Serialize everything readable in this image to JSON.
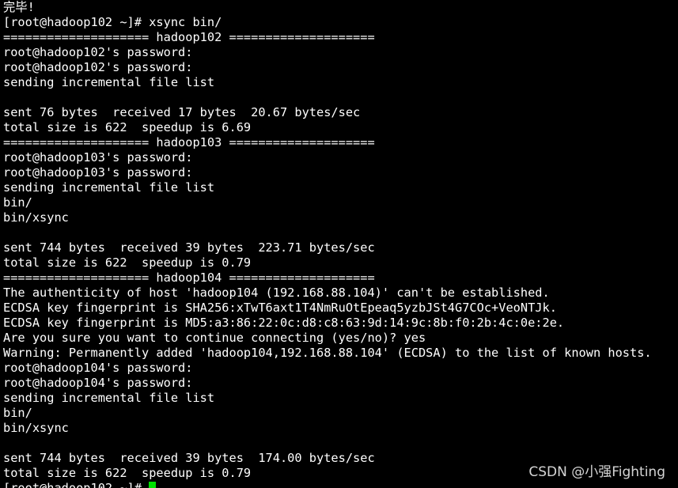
{
  "terminal": {
    "lines": [
      "完毕!",
      "[root@hadoop102 ~]# xsync bin/",
      "==================== hadoop102 ====================",
      "root@hadoop102's password:",
      "root@hadoop102's password:",
      "sending incremental file list",
      "",
      "sent 76 bytes  received 17 bytes  20.67 bytes/sec",
      "total size is 622  speedup is 6.69",
      "==================== hadoop103 ====================",
      "root@hadoop103's password:",
      "root@hadoop103's password:",
      "sending incremental file list",
      "bin/",
      "bin/xsync",
      "",
      "sent 744 bytes  received 39 bytes  223.71 bytes/sec",
      "total size is 622  speedup is 0.79",
      "==================== hadoop104 ====================",
      "The authenticity of host 'hadoop104 (192.168.88.104)' can't be established.",
      "ECDSA key fingerprint is SHA256:xTwT6axt1T4NmRuOtEpeaq5yzbJSt4G7COc+VeoNTJk.",
      "ECDSA key fingerprint is MD5:a3:86:22:0c:d8:c8:63:9d:14:9c:8b:f0:2b:4c:0e:2e.",
      "Are you sure you want to continue connecting (yes/no)? yes",
      "Warning: Permanently added 'hadoop104,192.168.88.104' (ECDSA) to the list of known hosts.",
      "root@hadoop104's password:",
      "root@hadoop104's password:",
      "sending incremental file list",
      "bin/",
      "bin/xsync",
      "",
      "sent 744 bytes  received 39 bytes  174.00 bytes/sec",
      "total size is 622  speedup is 0.79"
    ],
    "prompt": "[root@hadoop102 ~]# "
  },
  "watermark": "CSDN @小强Fighting",
  "colors": {
    "background": "#000000",
    "text": "#ffffff",
    "cursor": "#00e000"
  }
}
